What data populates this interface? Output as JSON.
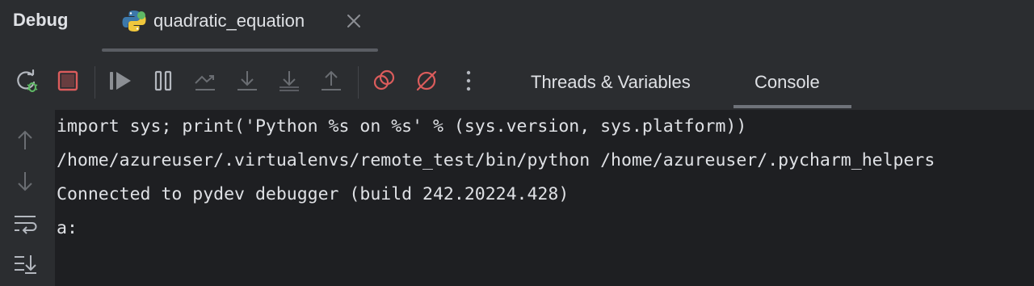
{
  "header": {
    "panel_title": "Debug",
    "tab": {
      "label": "quadratic_equation",
      "icon": "python-icon"
    }
  },
  "toolbar": {
    "buttons": [
      "rerun-debug-icon",
      "stop-icon",
      "resume-icon",
      "pause-icon",
      "step-over-icon",
      "step-into-icon",
      "step-into-my-code-icon",
      "step-out-icon",
      "view-breakpoints-icon",
      "mute-breakpoints-icon",
      "more-options-icon"
    ],
    "views": [
      {
        "label": "Threads & Variables"
      },
      {
        "label": "Console"
      }
    ],
    "active_view": "Console"
  },
  "gutter": {
    "buttons": [
      "up-arrow-icon",
      "down-arrow-icon",
      "soft-wrap-icon",
      "scroll-to-end-icon"
    ]
  },
  "console": {
    "lines": [
      "import sys; print('Python %s on %s' % (sys.version, sys.platform))",
      "/home/azureuser/.virtualenvs/remote_test/bin/python /home/azureuser/.pycharm_helpers",
      "Connected to pydev debugger (build 242.20224.428)",
      "a:"
    ]
  },
  "colors": {
    "background": "#1e1f22",
    "panel": "#2b2d30",
    "text": "#dfe1e5",
    "stop_red": "#db5c5c",
    "debug_green": "#5fb865"
  }
}
